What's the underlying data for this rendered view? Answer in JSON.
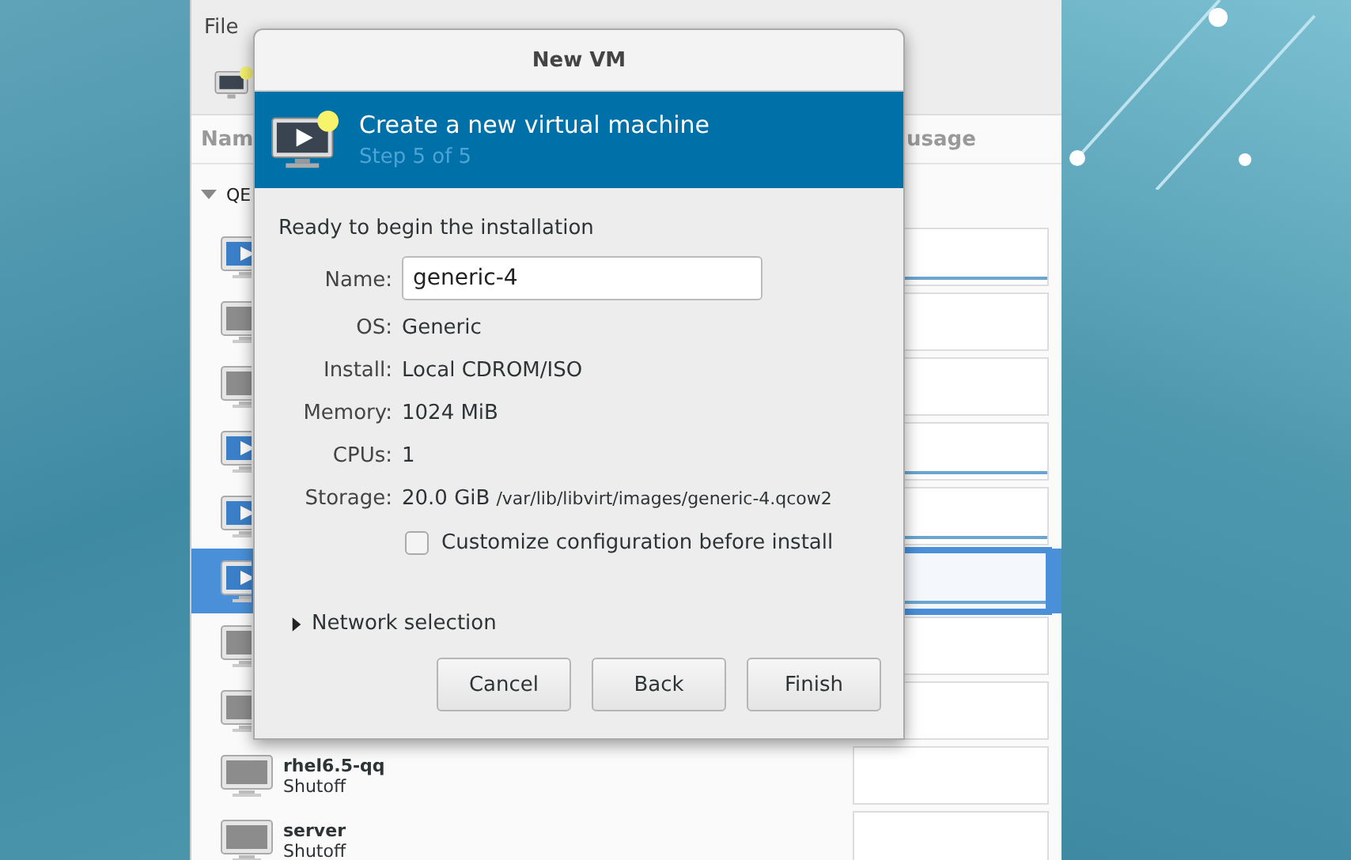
{
  "manager": {
    "menu": [
      "File"
    ],
    "columns": [
      "Nam",
      "usage"
    ],
    "group": {
      "label": "QE",
      "expanded": true
    },
    "vms": [
      {
        "running": true,
        "selected": false
      },
      {
        "running": false,
        "selected": false
      },
      {
        "running": false,
        "selected": false
      },
      {
        "running": true,
        "selected": false
      },
      {
        "running": true,
        "selected": false
      },
      {
        "running": true,
        "selected": true
      },
      {
        "running": false,
        "selected": false
      },
      {
        "running": false,
        "selected": false
      },
      {
        "name": "rhel6.5-qq",
        "status": "Shutoff",
        "running": false,
        "selected": false
      },
      {
        "name": "server",
        "status": "Shutoff",
        "running": false,
        "selected": false
      }
    ]
  },
  "dialog": {
    "title": "New VM",
    "header": {
      "title": "Create a new virtual machine",
      "step": "Step 5 of 5"
    },
    "intro": "Ready to begin the installation",
    "name_field": {
      "label": "Name:",
      "value": "generic-4"
    },
    "details": [
      {
        "label": "OS:",
        "value": "Generic"
      },
      {
        "label": "Install:",
        "value": "Local CDROM/ISO"
      },
      {
        "label": "Memory:",
        "value": "1024 MiB"
      },
      {
        "label": "CPUs:",
        "value": "1"
      },
      {
        "label": "Storage:",
        "value": "20.0 GiB",
        "path": "/var/lib/libvirt/images/generic-4.qcow2"
      }
    ],
    "customize": {
      "label": "Customize configuration before install",
      "checked": false
    },
    "network": {
      "label": "Network selection",
      "expanded": false
    },
    "buttons": [
      "Cancel",
      "Back",
      "Finish"
    ]
  }
}
